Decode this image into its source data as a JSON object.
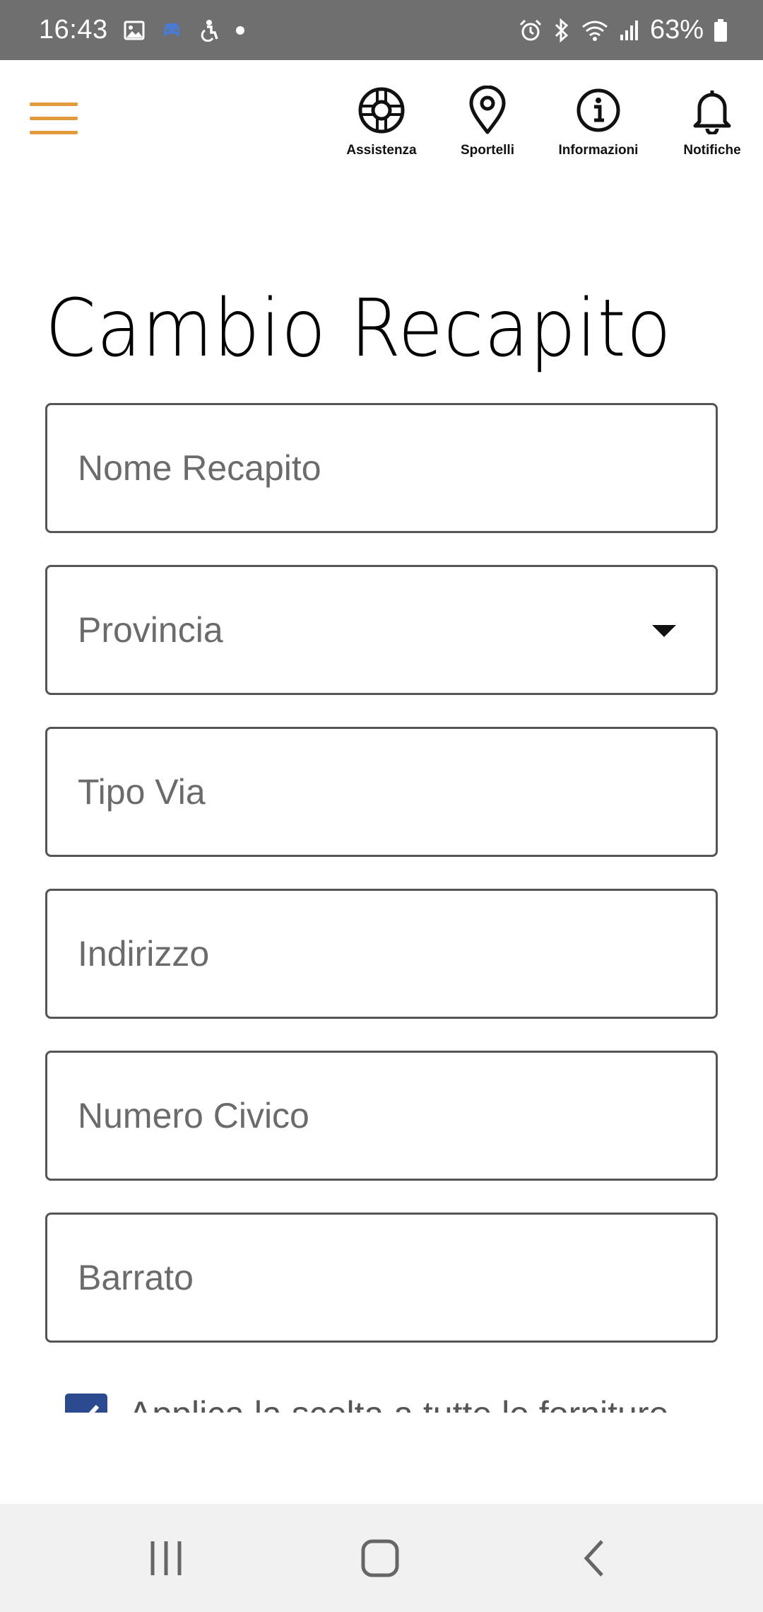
{
  "status_bar": {
    "time": "16:43",
    "battery": "63%",
    "left_icons": [
      "image-icon",
      "car-icon",
      "accessibility-icon",
      "dot-icon"
    ],
    "right_icons": [
      "alarm-icon",
      "bluetooth-icon",
      "wifi-icon",
      "signal-icon",
      "battery-icon"
    ],
    "car_icon_color": "#4a7bd0"
  },
  "header": {
    "menu_color": "#e29b3c",
    "nav": [
      {
        "label": "Assistenza",
        "icon": "lifebuoy-icon"
      },
      {
        "label": "Sportelli",
        "icon": "location-pin-icon"
      },
      {
        "label": "Informazioni",
        "icon": "info-icon"
      },
      {
        "label": "Notifiche",
        "icon": "bell-icon"
      }
    ]
  },
  "page": {
    "title": "Cambio Recapito"
  },
  "form": {
    "nome_recapito": {
      "placeholder": "Nome Recapito",
      "value": ""
    },
    "provincia": {
      "label": "Provincia"
    },
    "tipo_via": {
      "placeholder": "Tipo Via",
      "value": ""
    },
    "indirizzo": {
      "placeholder": "Indirizzo",
      "value": ""
    },
    "numero_civico": {
      "placeholder": "Numero Civico",
      "value": ""
    },
    "barrato": {
      "placeholder": "Barrato",
      "value": ""
    },
    "apply_all": {
      "label": "Applica la scelta a tutte le forniture",
      "checked": true
    }
  },
  "colors": {
    "checkbox": "#2b4a8f",
    "border": "#555555"
  }
}
